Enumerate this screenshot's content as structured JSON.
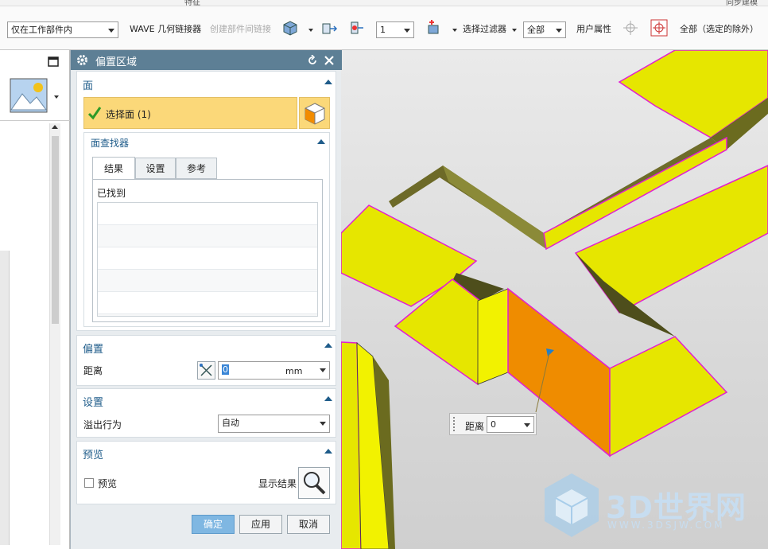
{
  "top_strip": {
    "left": "特征",
    "right": "同步建模"
  },
  "toolbar": {
    "scope_select": "仅在工作部件内",
    "wave_link": "WAVE 几何链接器",
    "create_link": "创建部件间链接",
    "num_select": "1",
    "filter_label": "选择过滤器",
    "filter_select": "全部",
    "user_attr": "用户属性",
    "all_except": "全部（选定的除外）"
  },
  "dialog": {
    "title": "偏置区域",
    "face_section": {
      "header": "面",
      "select_face": "选择面 (1)",
      "finder_header": "面查找器",
      "tabs": [
        "结果",
        "设置",
        "参考"
      ],
      "found_label": "已找到"
    },
    "offset_section": {
      "header": "偏置",
      "distance_label": "距离",
      "distance_value": "0",
      "unit": "mm"
    },
    "settings_section": {
      "header": "设置",
      "overflow_label": "溢出行为",
      "overflow_value": "自动"
    },
    "preview_section": {
      "header": "预览",
      "preview_checkbox": "预览",
      "show_result": "显示结果"
    },
    "buttons": {
      "ok": "确定",
      "apply": "应用",
      "cancel": "取消"
    }
  },
  "viewport": {
    "onscreen_label": "距离",
    "onscreen_value": "0",
    "watermark_title": "3D世界网",
    "watermark_url": "WWW.3DSJW.COM"
  },
  "colors": {
    "face_yellow": "#e6e600",
    "selected_orange": "#ef8c00",
    "edge_magenta": "#e21fd0",
    "title_blue": "#5d7f95"
  }
}
